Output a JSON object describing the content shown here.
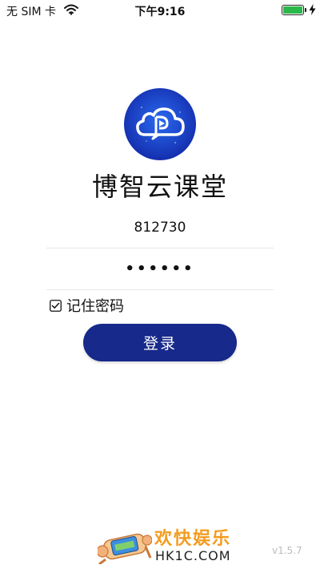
{
  "status_bar": {
    "carrier": "无 SIM 卡",
    "time": "下午9:16",
    "battery_level": 1.0,
    "icons": [
      "wifi-icon",
      "battery-icon",
      "charging-icon"
    ]
  },
  "app": {
    "title": "博智云课堂",
    "logo_icon": "cloud-play-logo"
  },
  "login": {
    "account_value": "812730",
    "password_value": "••••••",
    "remember_label": "记住密码",
    "remember_checked": true,
    "login_button_label": "登录"
  },
  "version": "v1.5.7",
  "watermark": {
    "text_cn": "欢快娱乐",
    "text_en": "HK1C.COM"
  },
  "colors": {
    "button": "#17298a",
    "logo_blue": "#1b3fd1",
    "watermark_orange": "#f39c1f",
    "battery_green": "#2bb84a"
  }
}
